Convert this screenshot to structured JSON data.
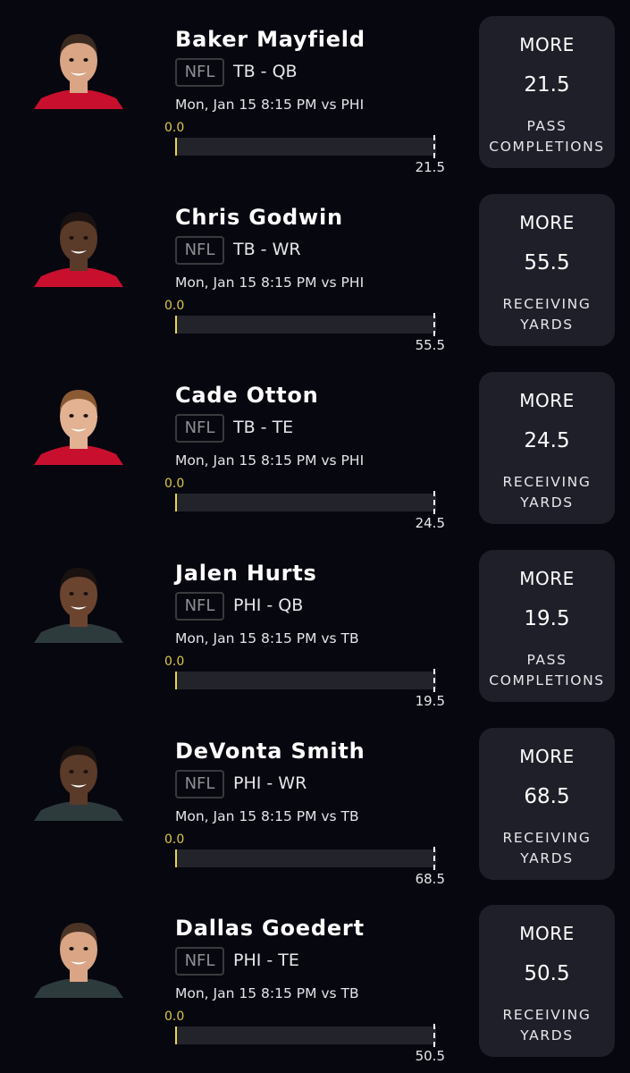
{
  "picks": [
    {
      "player": "Baker Mayfield",
      "league": "NFL",
      "team_pos": "TB - QB",
      "game_time": "Mon, Jan 15 8:15 PM  vs PHI",
      "progress_start": "0.0",
      "progress_end": "21.5",
      "direction": "MORE",
      "line": "21.5",
      "stat": "PASS COMPLETIONS",
      "jersey_color": "#c8102e",
      "skin": "#d9a585",
      "hair": "#3b2a20"
    },
    {
      "player": "Chris Godwin",
      "league": "NFL",
      "team_pos": "TB - WR",
      "game_time": "Mon, Jan 15 8:15 PM  vs PHI",
      "progress_start": "0.0",
      "progress_end": "55.5",
      "direction": "MORE",
      "line": "55.5",
      "stat": "RECEIVING YARDS",
      "jersey_color": "#c8102e",
      "skin": "#5a3a28",
      "hair": "#1a1210"
    },
    {
      "player": "Cade Otton",
      "league": "NFL",
      "team_pos": "TB - TE",
      "game_time": "Mon, Jan 15 8:15 PM  vs PHI",
      "progress_start": "0.0",
      "progress_end": "24.5",
      "direction": "MORE",
      "line": "24.5",
      "stat": "RECEIVING YARDS",
      "jersey_color": "#c8102e",
      "skin": "#e2b293",
      "hair": "#8a5a33"
    },
    {
      "player": "Jalen Hurts",
      "league": "NFL",
      "team_pos": "PHI - QB",
      "game_time": "Mon, Jan 15 8:15 PM  vs TB",
      "progress_start": "0.0",
      "progress_end": "19.5",
      "direction": "MORE",
      "line": "19.5",
      "stat": "PASS COMPLETIONS",
      "jersey_color": "#2e3b3d",
      "skin": "#6b4430",
      "hair": "#1a1210"
    },
    {
      "player": "DeVonta Smith",
      "league": "NFL",
      "team_pos": "PHI - WR",
      "game_time": "Mon, Jan 15 8:15 PM  vs TB",
      "progress_start": "0.0",
      "progress_end": "68.5",
      "direction": "MORE",
      "line": "68.5",
      "stat": "RECEIVING YARDS",
      "jersey_color": "#2e3b3d",
      "skin": "#5a3a28",
      "hair": "#1a1210"
    },
    {
      "player": "Dallas Goedert",
      "league": "NFL",
      "team_pos": "PHI - TE",
      "game_time": "Mon, Jan 15 8:15 PM  vs TB",
      "progress_start": "0.0",
      "progress_end": "50.5",
      "direction": "MORE",
      "line": "50.5",
      "stat": "RECEIVING YARDS",
      "jersey_color": "#2e3b3d",
      "skin": "#d9a585",
      "hair": "#4a3425"
    }
  ]
}
